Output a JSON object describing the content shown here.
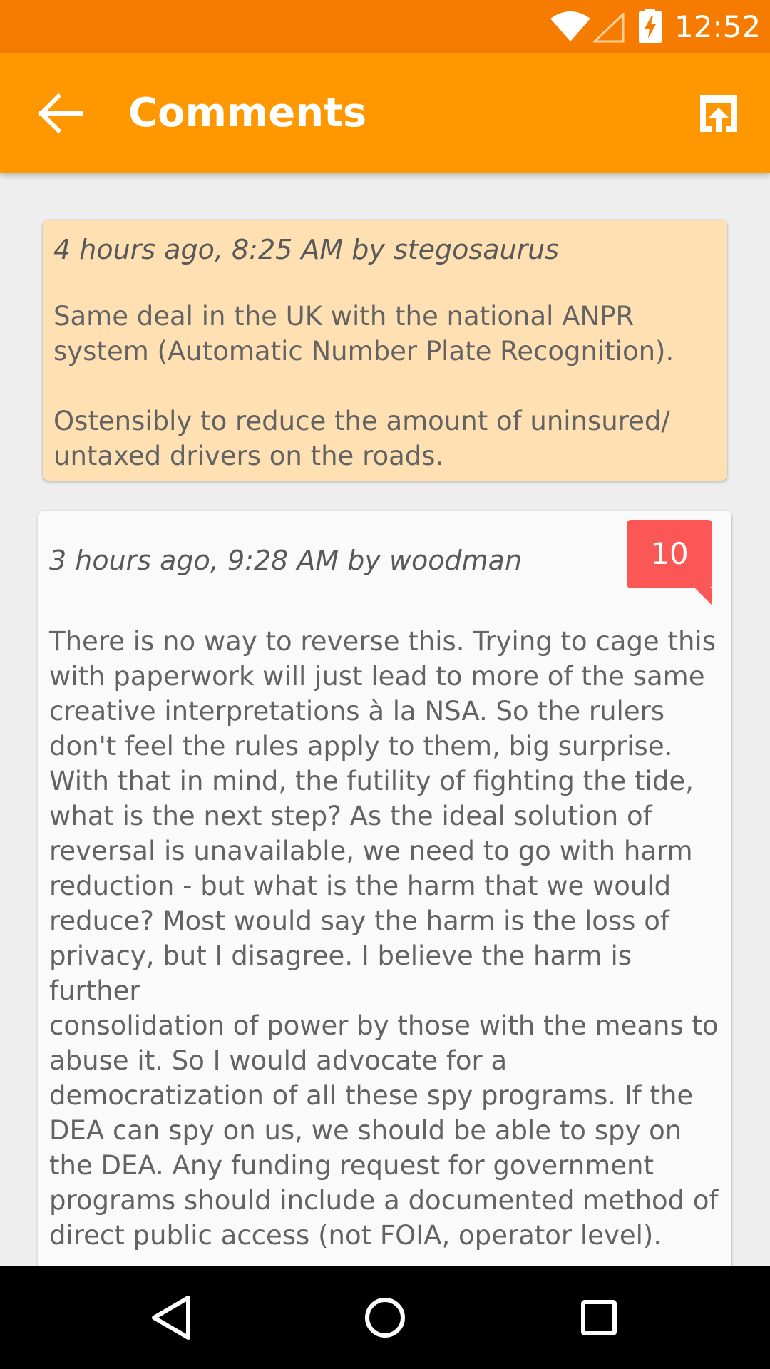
{
  "status_bar": {
    "time": "12:52",
    "icons": [
      "wifi-icon",
      "cell-signal-icon",
      "battery-charging-icon"
    ]
  },
  "app_bar": {
    "title": "Comments",
    "back_icon": "arrow-left-icon",
    "action_icon": "open-in-browser-icon"
  },
  "comments": [
    {
      "meta": "4 hours ago, 8:25 AM by stegosaurus",
      "body": "Same deal in the UK with the national ANPR\nsystem (Automatic Number Plate Recognition).\n\nOstensibly to reduce the amount of uninsured/\nuntaxed drivers on the roads.",
      "highlighted": true
    },
    {
      "meta": "3 hours ago, 9:28 AM by woodman",
      "score": "10",
      "body": "There is no way to reverse this. Trying to cage this\nwith paperwork will just lead to more of the same\ncreative interpretations à la NSA. So the rulers\ndon't feel the rules apply to them, big surprise.\nWith that in mind, the futility of fighting the tide,\nwhat is the next step? As the ideal solution of\nreversal is unavailable, we need to go with harm\nreduction - but what is the harm that we would\nreduce? Most would say the harm is the loss of\nprivacy, but I disagree. I believe the harm is further\nconsolidation of power by those with the means to\nabuse it. So I would advocate for a\ndemocratization of all these spy programs. If the\nDEA can spy on us, we should be able to spy on\nthe DEA. Any funding request for government\nprograms should include a documented method of\ndirect public access (not FOIA, operator level).\n\nIt is my contention the Constitution included the",
      "highlighted": false
    }
  ],
  "nav_bar": {
    "buttons": [
      "back-triangle-icon",
      "home-circle-icon",
      "recents-square-icon"
    ]
  },
  "colors": {
    "status_bar": "#f57c00",
    "app_bar": "#ff9800",
    "highlight_card": "#ffe0b2",
    "score_badge": "#fc5757",
    "background": "#eeeeee"
  }
}
